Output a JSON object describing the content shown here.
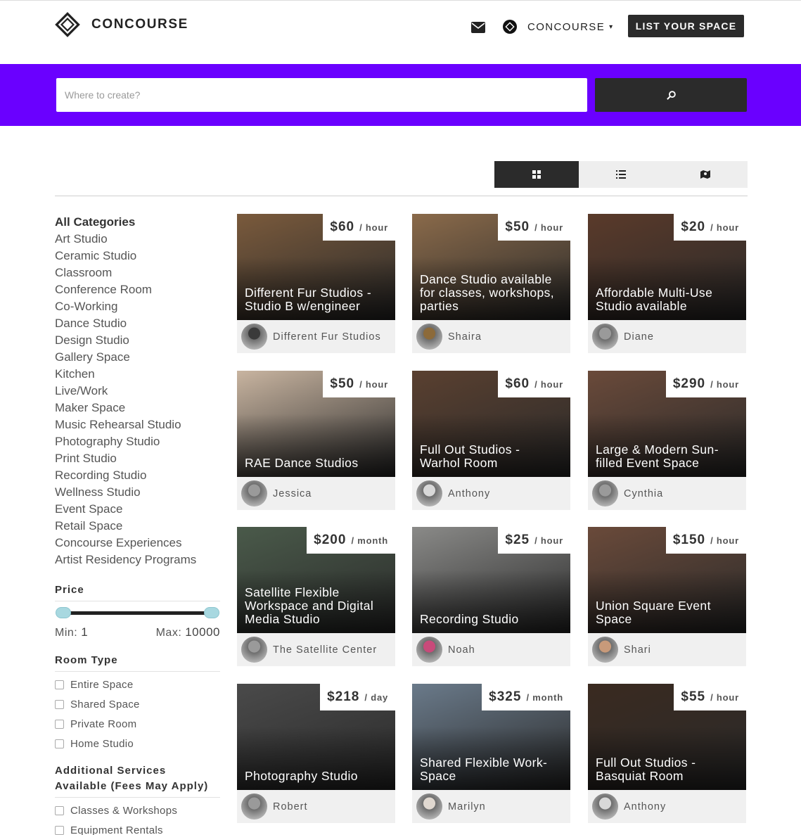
{
  "header": {
    "brand": "CONCOURSE",
    "account_name": "CONCOURSE",
    "account_caret": "▾",
    "list_button": "LIST YOUR SPACE"
  },
  "search": {
    "placeholder": "Where to create?",
    "value": ""
  },
  "view_toggle": {
    "options": [
      "grid-icon",
      "list-icon",
      "map-icon"
    ],
    "active": "grid"
  },
  "sidebar": {
    "categories_title": "All Categories",
    "categories": [
      "Art Studio",
      "Ceramic Studio",
      "Classroom",
      "Conference Room",
      "Co-Working",
      "Dance Studio",
      "Design Studio",
      "Gallery Space",
      "Kitchen",
      "Live/Work",
      "Maker Space",
      "Music Rehearsal Studio",
      "Photography Studio",
      "Print Studio",
      "Recording Studio",
      "Wellness Studio",
      "Event Space",
      "Retail Space",
      "Concourse Experiences",
      "Artist Residency Programs"
    ],
    "price": {
      "title": "Price",
      "min_label": "Min:",
      "min_value": "1",
      "max_label": "Max:",
      "max_value": "10000"
    },
    "room_type": {
      "title": "Room Type",
      "options": [
        "Entire Space",
        "Shared Space",
        "Private Room",
        "Home Studio"
      ]
    },
    "services": {
      "title_line1": "Additional Services",
      "title_line2": "Available (Fees May Apply)",
      "options": [
        "Classes & Workshops",
        "Equipment Rentals"
      ]
    }
  },
  "listings": [
    {
      "price": "$60",
      "unit": "/ hour",
      "title": "Different Fur Studios - Studio B w/engineer",
      "host": "Different Fur Studios",
      "scene": "#7a5a3c",
      "avatar": "#3a3a3a"
    },
    {
      "price": "$50",
      "unit": "/ hour",
      "title": "Dance Studio available for classes, workshops, parties",
      "host": "Shaira",
      "scene": "#8a6a4a",
      "avatar": "#8c6a3a"
    },
    {
      "price": "$20",
      "unit": "/ hour",
      "title": "Affordable Multi-Use Studio available",
      "host": "Diane",
      "scene": "#5a3a2a",
      "avatar": "#9a9a9a"
    },
    {
      "price": "$50",
      "unit": "/ hour",
      "title": "RAE Dance Studios",
      "host": "Jessica",
      "scene": "#c8b4a0",
      "avatar": "#9a9a9a"
    },
    {
      "price": "$60",
      "unit": "/ hour",
      "title": "Full Out Studios - Warhol Room",
      "host": "Anthony",
      "scene": "#5a4030",
      "avatar": "#d8d8d8"
    },
    {
      "price": "$290",
      "unit": "/ hour",
      "title": "Large & Modern Sun-filled Event Space",
      "host": "Cynthia",
      "scene": "#6a4a3a",
      "avatar": "#9a9a9a"
    },
    {
      "price": "$200",
      "unit": "/ month",
      "title": "Satellite Flexible Workspace and Digital Media Studio",
      "host": "The Satellite Center",
      "scene": "#4a5a4a",
      "avatar": "#9a9a9a"
    },
    {
      "price": "$25",
      "unit": "/ hour",
      "title": "Recording Studio",
      "host": "Noah",
      "scene": "#8a8a88",
      "avatar": "#c84a7a"
    },
    {
      "price": "$150",
      "unit": "/ hour",
      "title": "Union Square Event Space",
      "host": "Shari",
      "scene": "#6a4a3a",
      "avatar": "#c89a7a"
    },
    {
      "price": "$218",
      "unit": "/ day",
      "title": "Photography Studio",
      "host": "Robert",
      "scene": "#4a4a4a",
      "avatar": "#9a9a9a"
    },
    {
      "price": "$325",
      "unit": "/ month",
      "title": "Shared Flexible Work-Space",
      "host": "Marilyn",
      "scene": "#6a7a8a",
      "avatar": "#e0d8d0"
    },
    {
      "price": "$55",
      "unit": "/ hour",
      "title": "Full Out Studios - Basquiat Room",
      "host": "Anthony",
      "scene": "#3a2a20",
      "avatar": "#d8d8d8"
    }
  ],
  "colors": {
    "brand_purple": "#6a00ff",
    "dark_button": "#2b2b2b",
    "slider_handle": "#a8d8e0"
  }
}
